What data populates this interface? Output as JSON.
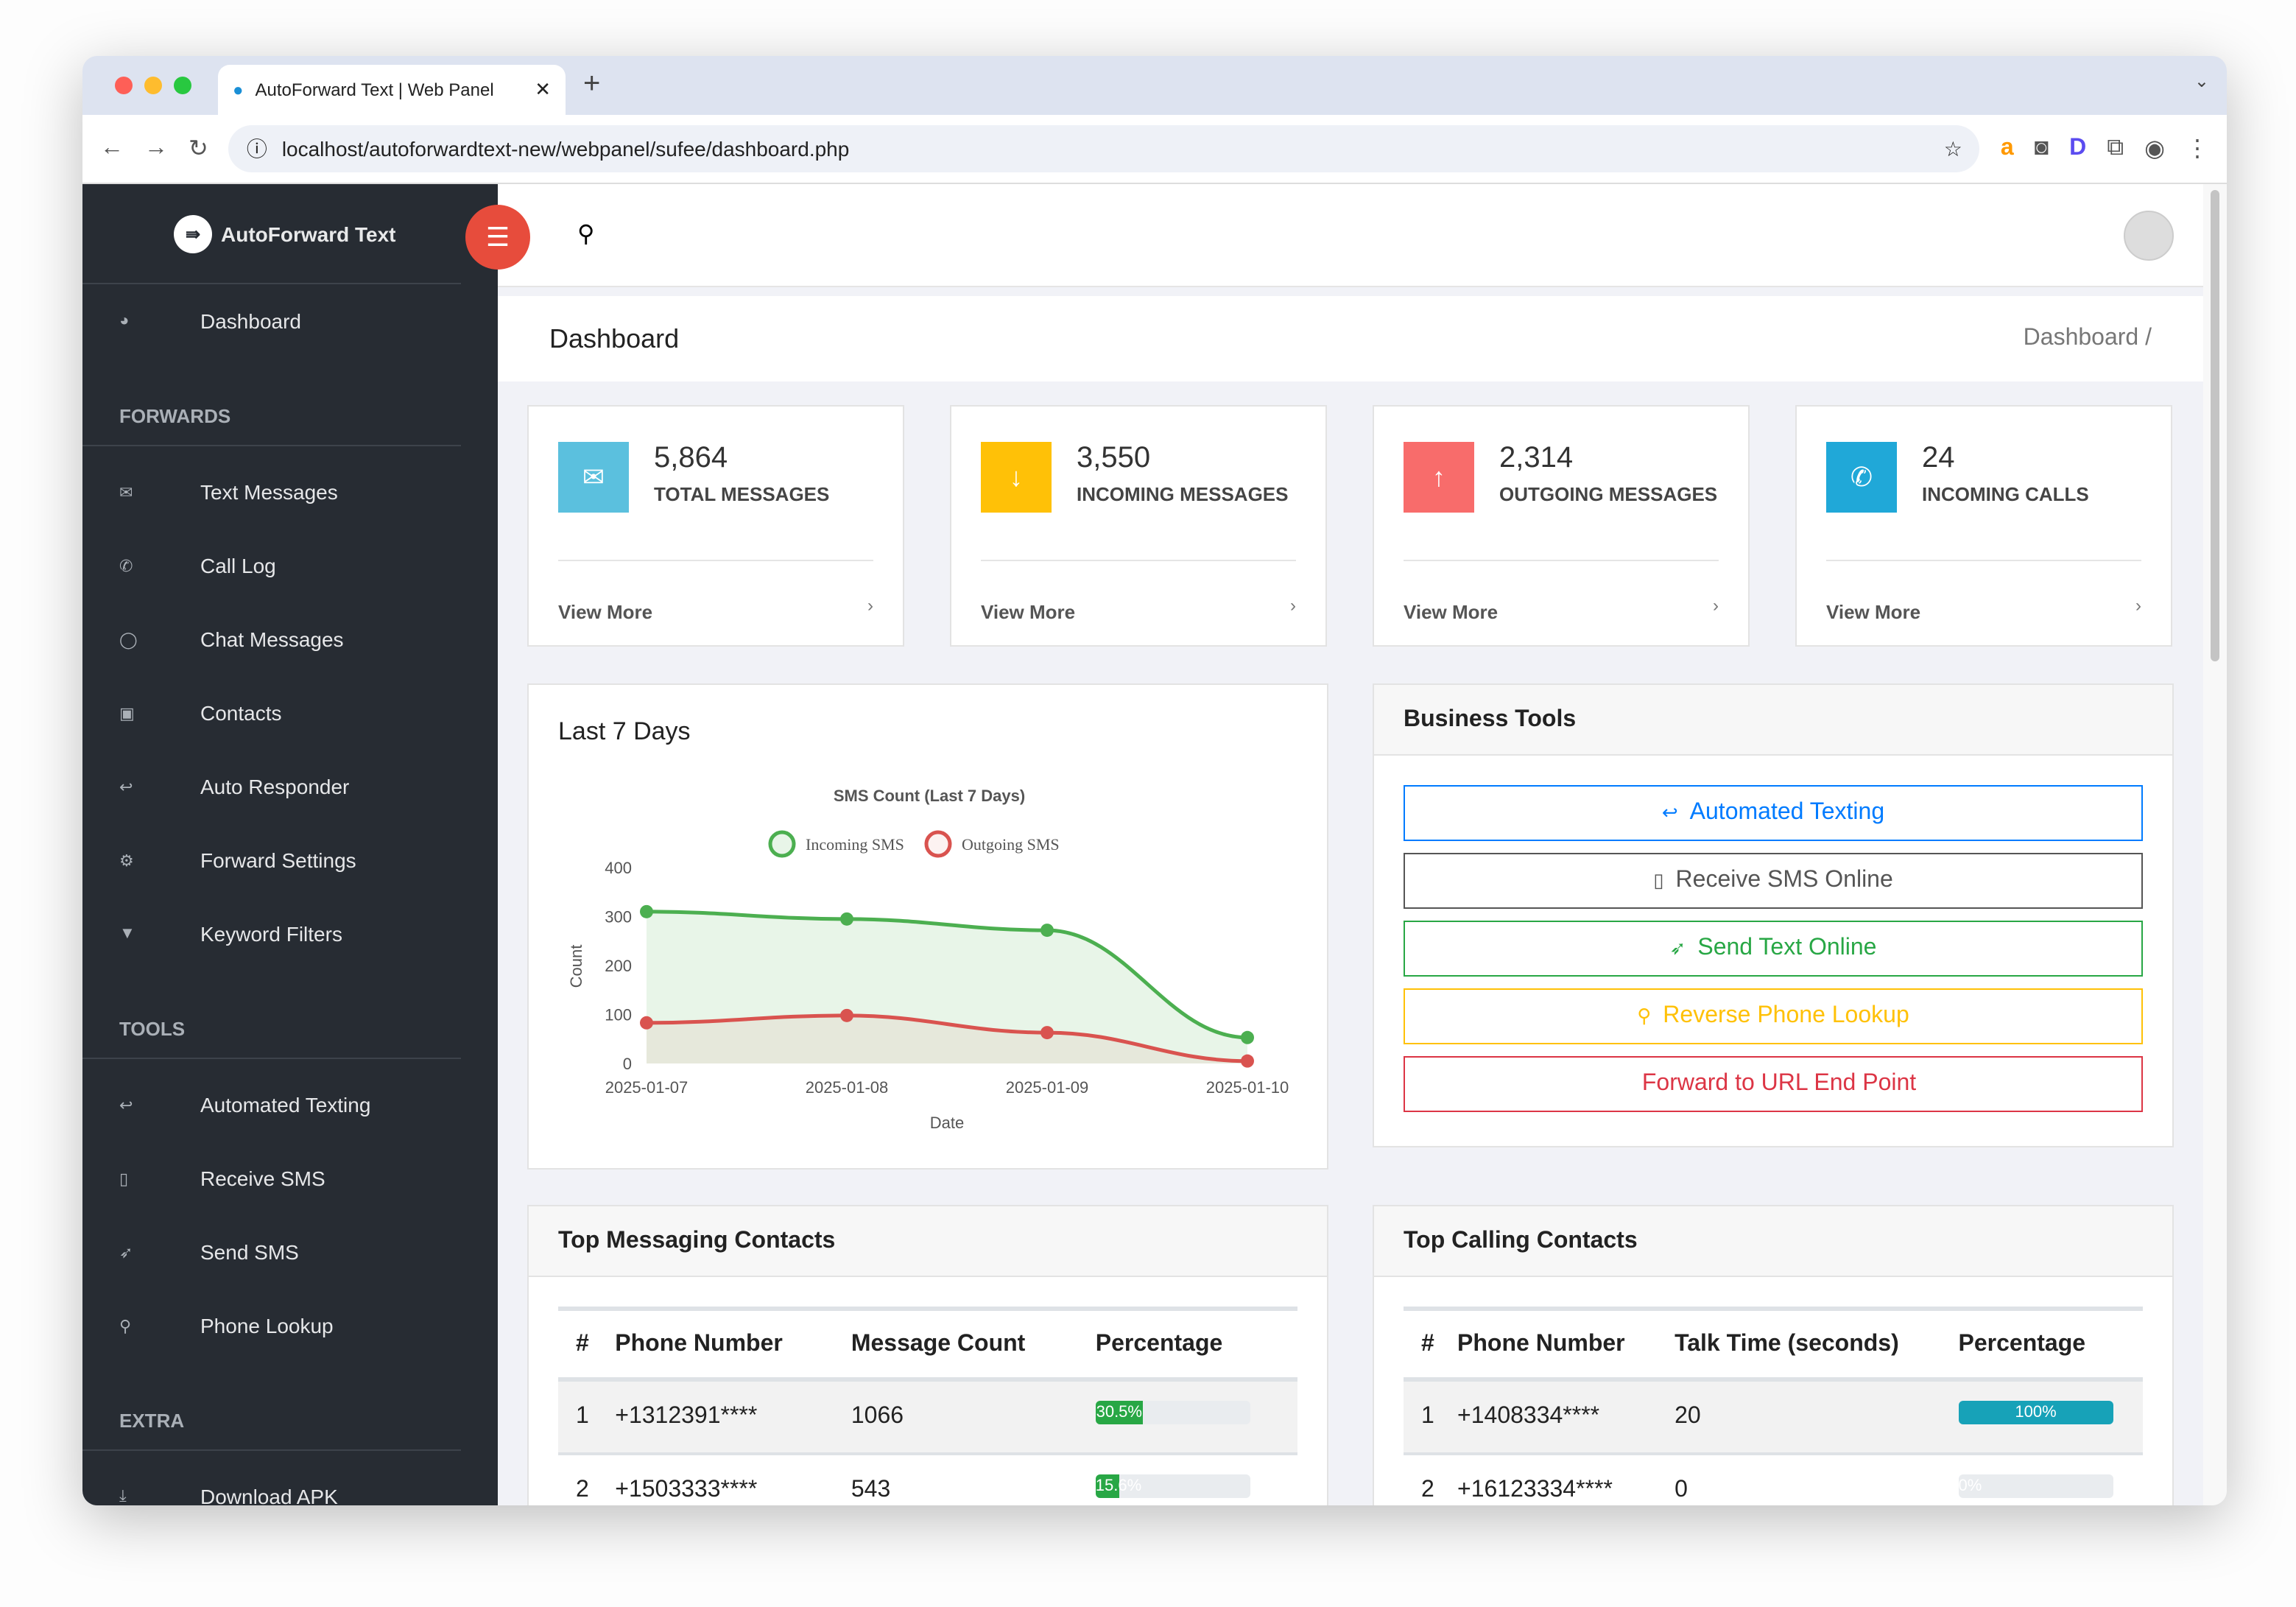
{
  "browser": {
    "tab_title": "AutoForward Text | Web Panel",
    "url": "localhost/autoforwardtext-new/webpanel/sufee/dashboard.php"
  },
  "sidebar": {
    "brand": "AutoForward Text",
    "dashboard": "Dashboard",
    "sections": [
      {
        "title": "FORWARDS",
        "items": [
          {
            "label": "Text Messages",
            "icon": "envelope"
          },
          {
            "label": "Call Log",
            "icon": "phone"
          },
          {
            "label": "Chat Messages",
            "icon": "comment"
          },
          {
            "label": "Contacts",
            "icon": "address-book"
          },
          {
            "label": "Auto Responder",
            "icon": "reply"
          },
          {
            "label": "Forward Settings",
            "icon": "gears"
          },
          {
            "label": "Keyword Filters",
            "icon": "filter"
          }
        ]
      },
      {
        "title": "TOOLS",
        "items": [
          {
            "label": "Automated Texting",
            "icon": "reply"
          },
          {
            "label": "Receive SMS",
            "icon": "mobile"
          },
          {
            "label": "Send SMS",
            "icon": "rocket"
          },
          {
            "label": "Phone Lookup",
            "icon": "search"
          }
        ]
      },
      {
        "title": "EXTRA",
        "items": [
          {
            "label": "Download APK",
            "icon": "download"
          }
        ]
      }
    ]
  },
  "header": {
    "page_title": "Dashboard",
    "breadcrumb": "Dashboard /"
  },
  "stats": [
    {
      "value": "5,864",
      "label": "TOTAL MESSAGES",
      "link": "View More",
      "color": "#5bc0de",
      "icon": "envelope"
    },
    {
      "value": "3,550",
      "label": "INCOMING MESSAGES",
      "link": "View More",
      "color": "#ffc107",
      "icon": "arrow-down"
    },
    {
      "value": "2,314",
      "label": "OUTGOING MESSAGES",
      "link": "View More",
      "color": "#f86c6b",
      "icon": "arrow-up"
    },
    {
      "value": "24",
      "label": "INCOMING CALLS",
      "link": "View More",
      "color": "#20a8d8",
      "icon": "phone"
    }
  ],
  "chart_card_title": "Last 7 Days",
  "chart_data": {
    "type": "area",
    "title": "SMS Count (Last 7 Days)",
    "xlabel": "Date",
    "ylabel": "Count",
    "ylim": [
      0,
      400
    ],
    "yticks": [
      0,
      100,
      200,
      300,
      400
    ],
    "legend": "top",
    "categories": [
      "2025-01-07",
      "2025-01-08",
      "2025-01-09",
      "2025-01-10"
    ],
    "series": [
      {
        "name": "Incoming SMS",
        "values": [
          310,
          295,
          272,
          53
        ],
        "color": "#4caf50"
      },
      {
        "name": "Outgoing SMS",
        "values": [
          83,
          98,
          63,
          5
        ],
        "color": "#d9534f"
      }
    ]
  },
  "business_tools": {
    "title": "Business Tools",
    "buttons": [
      {
        "label": "Automated Texting",
        "color": "#007bff",
        "icon": "reply"
      },
      {
        "label": "Receive SMS Online",
        "color": "#555555",
        "icon": "mobile"
      },
      {
        "label": "Send Text Online",
        "color": "#28a745",
        "icon": "rocket"
      },
      {
        "label": "Reverse Phone Lookup",
        "color": "#ffc107",
        "icon": "search"
      },
      {
        "label": "Forward to URL End Point",
        "color": "#dc3545",
        "icon": "code"
      }
    ]
  },
  "top_messaging": {
    "title": "Top Messaging Contacts",
    "columns": [
      "#",
      "Phone Number",
      "Message Count",
      "Percentage"
    ],
    "rows": [
      {
        "n": "1",
        "phone": "+1312391****",
        "count": "1066",
        "pct": "30.5%",
        "fill": 30.5
      },
      {
        "n": "2",
        "phone": "+1503333****",
        "count": "543",
        "pct": "15.6%",
        "fill": 15.6
      }
    ]
  },
  "top_calling": {
    "title": "Top Calling Contacts",
    "columns": [
      "#",
      "Phone Number",
      "Talk Time (seconds)",
      "Percentage"
    ],
    "rows": [
      {
        "n": "1",
        "phone": "+1408334****",
        "count": "20",
        "pct": "100%",
        "fill": 100
      },
      {
        "n": "2",
        "phone": "+16123334****",
        "count": "0",
        "pct": "0%",
        "fill": 0
      }
    ]
  }
}
